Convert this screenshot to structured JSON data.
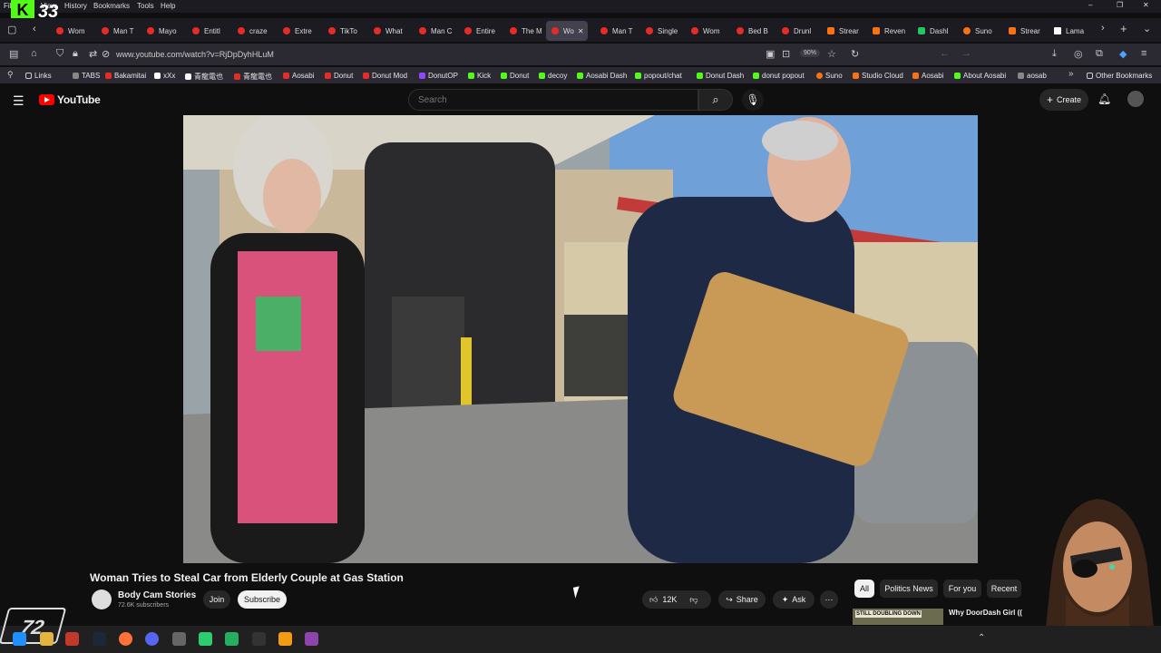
{
  "browser": {
    "menu": [
      "File",
      "View",
      "History",
      "Bookmarks",
      "Tools",
      "Help"
    ],
    "tabs": [
      "Wom",
      "Man T",
      "Mayo",
      "Entitl",
      "craze",
      "Extre",
      "TikTo",
      "What",
      "Man C",
      "Entire",
      "The M",
      "Wo",
      "Man T",
      "Single",
      "Wom",
      "Bed B",
      "Drunl",
      "Strear",
      "Reven",
      "Dashl",
      "Suno",
      "Strear",
      "Lama"
    ],
    "active_tab_index": 11,
    "url": "www.youtube.com/watch?v=RjDpDyhHLuM",
    "zoom": "90%",
    "bookmarks": [
      "Links",
      "TABS",
      "Bakamitai",
      "xXx",
      "青龍電也",
      "青龍電也",
      "Aosabi",
      "Donut",
      "Donut Mod",
      "DonutOP",
      "Kick",
      "Donut",
      "decoy",
      "Aosabi Dash",
      "popout/chat",
      "Donut Dash",
      "donut popout",
      "Suno",
      "Studio Cloud",
      "Aosabi",
      "About Aosabi",
      "aosab",
      "Other Bookmarks"
    ]
  },
  "overlay": {
    "logo_letter": "K",
    "logo_number": "33"
  },
  "youtube": {
    "logo_text": "YouTube",
    "search_placeholder": "Search",
    "create_label": "Create",
    "video": {
      "title": "Woman Tries to Steal Car from Elderly Couple at Gas Station",
      "channel": "Body Cam Stories",
      "subscribers": "72.6K subscribers",
      "join_label": "Join",
      "subscribe_label": "Subscribe",
      "likes": "12K",
      "share_label": "Share",
      "ask_label": "Ask"
    },
    "chips": [
      "All",
      "Politics News",
      "For you",
      "Recent"
    ],
    "recommendation": {
      "thumb_text": "STILL DOUBLING DOWN",
      "title": "Why DoorDash Girl (("
    }
  },
  "colors": {
    "youtube_red": "#ff0000",
    "kick_green": "#53fc18",
    "bg": "#0f0f0f"
  }
}
